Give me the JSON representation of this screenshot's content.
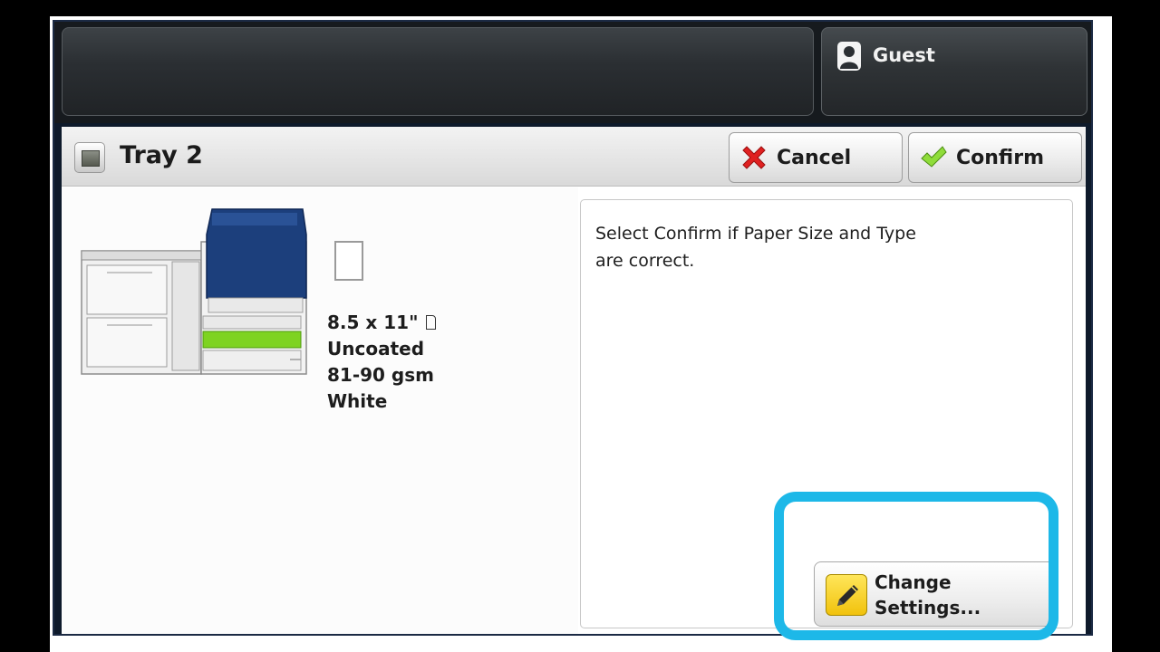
{
  "header": {
    "user_name": "Guest",
    "user_icon": "user-icon"
  },
  "title_bar": {
    "title": "Tray 2",
    "tray_icon": "tray-icon",
    "cancel_label": "Cancel",
    "cancel_icon": "red-x-icon",
    "confirm_label": "Confirm",
    "confirm_icon": "green-check-icon"
  },
  "paper": {
    "size": "8.5 x 11\"",
    "orientation_icon": "portrait-orientation-icon",
    "type": "Uncoated",
    "weight": "81-90 gsm",
    "color": "White"
  },
  "message": "Select Confirm if Paper Size and Type are correct.",
  "change_settings": {
    "line1": "Change",
    "line2": "Settings...",
    "icon": "pencil-icon"
  },
  "colors": {
    "highlight": "#1db8e8",
    "printer_blue": "#1c3f7c",
    "tray_green": "#7ed321",
    "cancel_red": "#e02020",
    "confirm_green": "#7ed321"
  }
}
